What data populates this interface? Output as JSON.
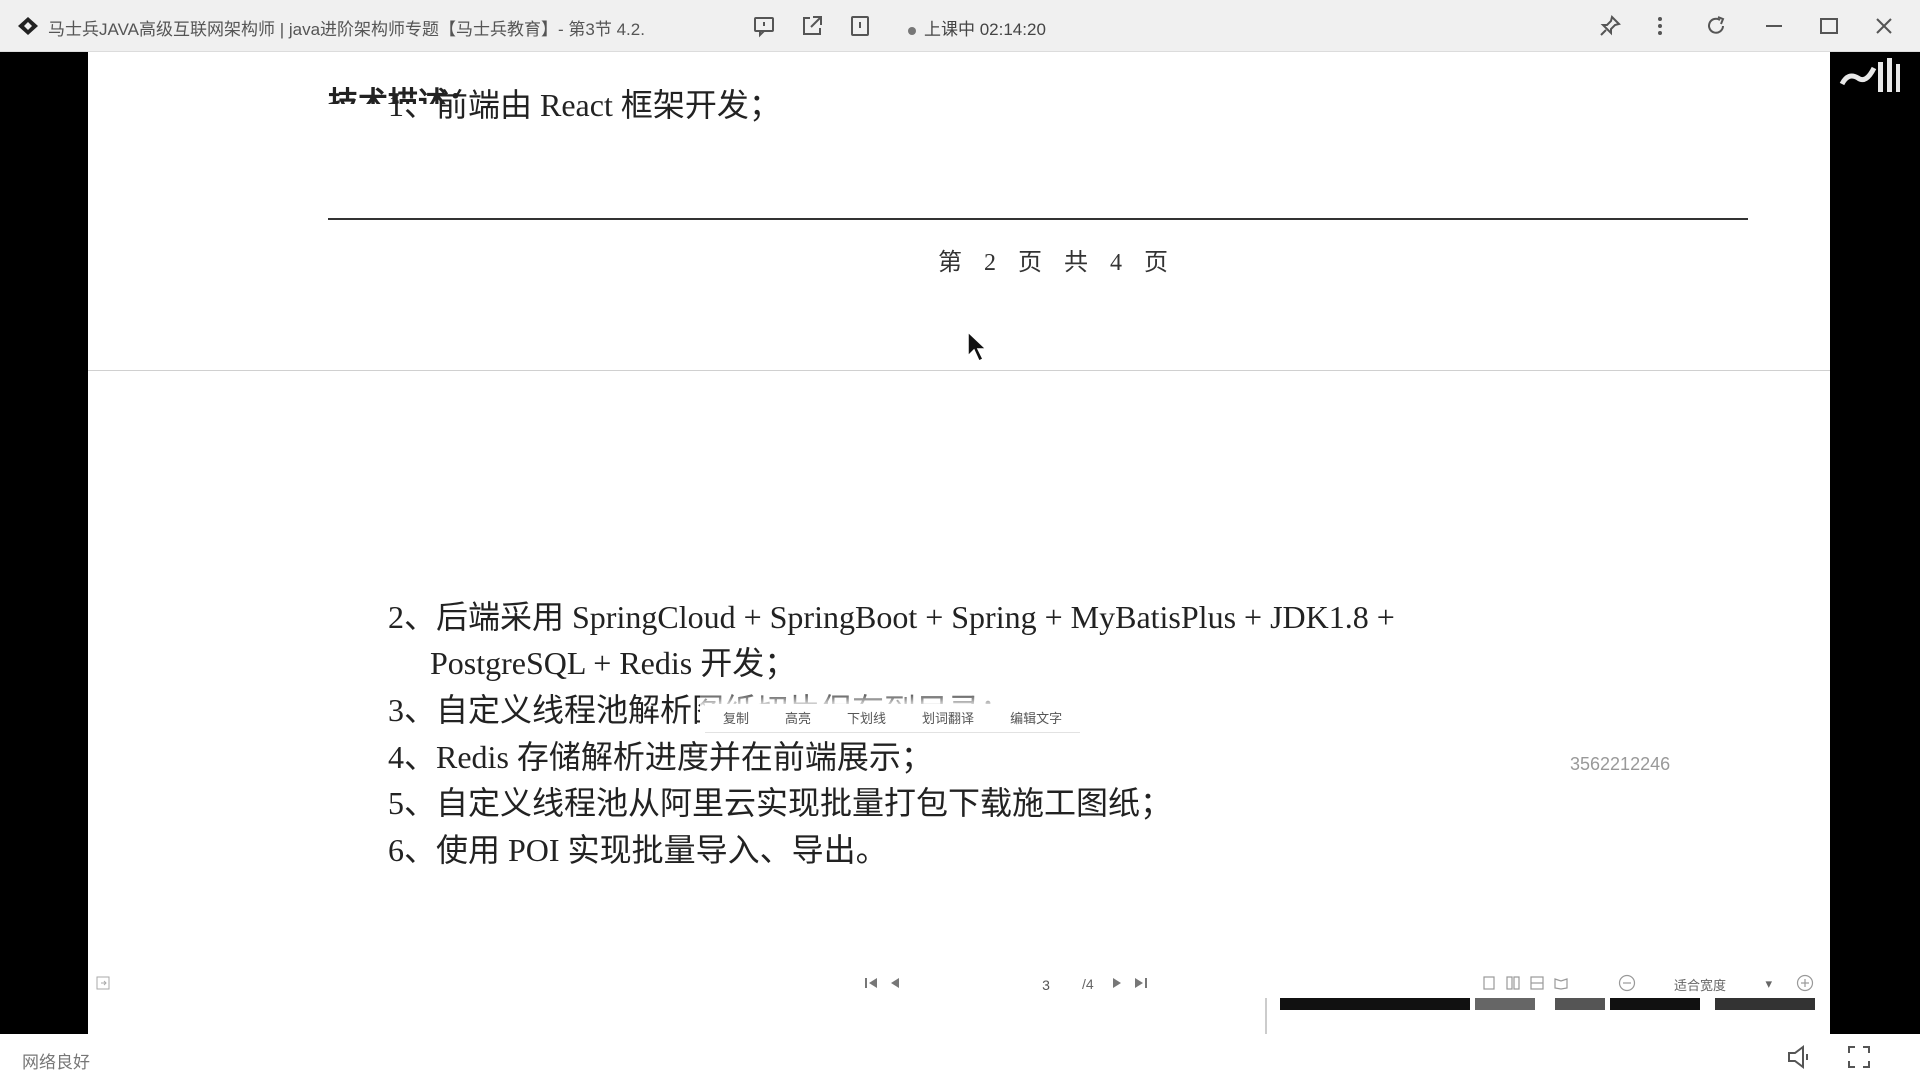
{
  "titlebar": {
    "title": "马士兵JAVA高级互联网架构师 | java进阶架构师专题【马士兵教育】- 第3节 4.2.",
    "live_status": "上课中 02:14:20",
    "icons": [
      "chat-icon",
      "share-icon",
      "pip-icon",
      "pin-icon",
      "more-icon",
      "refresh-icon",
      "minimize-icon",
      "maximize-icon",
      "close-icon"
    ]
  },
  "document": {
    "cut_heading": "技术描述：",
    "line1": "1、前端由 React 框架开发；",
    "page_footer": "第 2 页 共 4 页",
    "line2a": "2、后端采用 SpringCloud + SpringBoot + Spring + MyBatisPlus + JDK1.8 +",
    "line2b": "PostgreSQL + Redis 开发；",
    "line3": "3、自定义线程池解析图纸切片保存到目录；",
    "line4": "4、Redis 存储解析进度并在前端展示；",
    "line5": "5、自定义线程池从阿里云实现批量打包下载施工图纸；",
    "line6": "6、使用 POI 实现批量导入、导出。"
  },
  "context_toolbar": {
    "items": [
      "复制",
      "高亮",
      "下划线",
      "划词翻译",
      "编辑文字"
    ]
  },
  "watermark": {
    "user_id": "3562212246"
  },
  "viewer_toolbar": {
    "current_page": "3",
    "total_pages": "/4",
    "zoom_label": "适合宽度",
    "zoom_caret": "▾"
  },
  "status_bar": {
    "network": "网络良好"
  },
  "colors": {
    "titlebar_bg": "#f0f0f0",
    "side_bars": "#000000",
    "doc_text": "#222222"
  }
}
